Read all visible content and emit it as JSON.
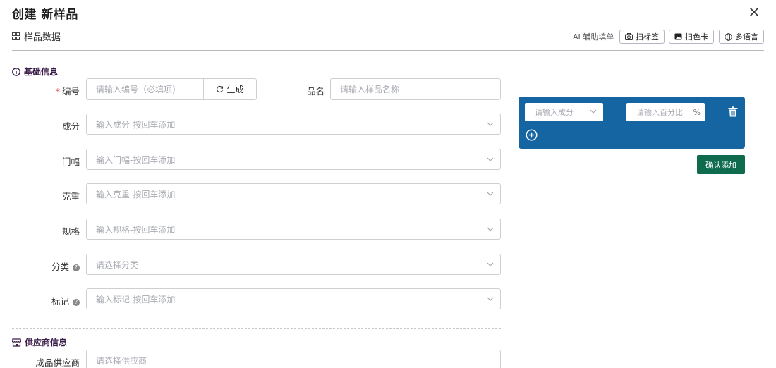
{
  "dialog": {
    "title": "创建 新样品"
  },
  "tab": {
    "label": "样品数据"
  },
  "toolbar": {
    "ai_label": "AI 辅助填单",
    "scan_label": "扫标签",
    "scan_color_card": "扫色卡",
    "multi_language": "多语言"
  },
  "basic": {
    "section_title": "基础信息",
    "code": {
      "required_mark": "*",
      "label": "编号",
      "placeholder": "请输入编号（必填项)",
      "generate": "生成"
    },
    "name": {
      "label": "品名",
      "placeholder": "请输入样品名称"
    },
    "composition": {
      "label": "成分",
      "placeholder": "输入成分-按回车添加"
    },
    "width": {
      "label": "门幅",
      "placeholder": "输入门幅-按回车添加"
    },
    "weight": {
      "label": "克重",
      "placeholder": "输入克重-按回车添加"
    },
    "spec": {
      "label": "规格",
      "placeholder": "输入规格-按回车添加"
    },
    "category": {
      "label": "分类",
      "placeholder": "请选择分类"
    },
    "tag": {
      "label": "标记",
      "placeholder": "输入标记-按回车添加"
    }
  },
  "supplier": {
    "section_title": "供应商信息",
    "finished_supplier": {
      "label": "成品供应商",
      "placeholder": "请选择供应商"
    }
  },
  "composition_panel": {
    "component_placeholder": "请输入成分",
    "percent_placeholder": "请输入百分比",
    "percent_suffix": "%",
    "confirm": "确认添加"
  },
  "colors": {
    "panel": "#1565a3",
    "confirm": "#0e6b4e",
    "required": "#e04b4b"
  },
  "icons": [
    "close-icon",
    "grid-icon",
    "camera-icon",
    "image-icon",
    "globe-icon",
    "info-icon",
    "refresh-icon",
    "chevron-down-icon",
    "help-icon",
    "store-icon",
    "trash-icon",
    "plus-circle-icon"
  ]
}
